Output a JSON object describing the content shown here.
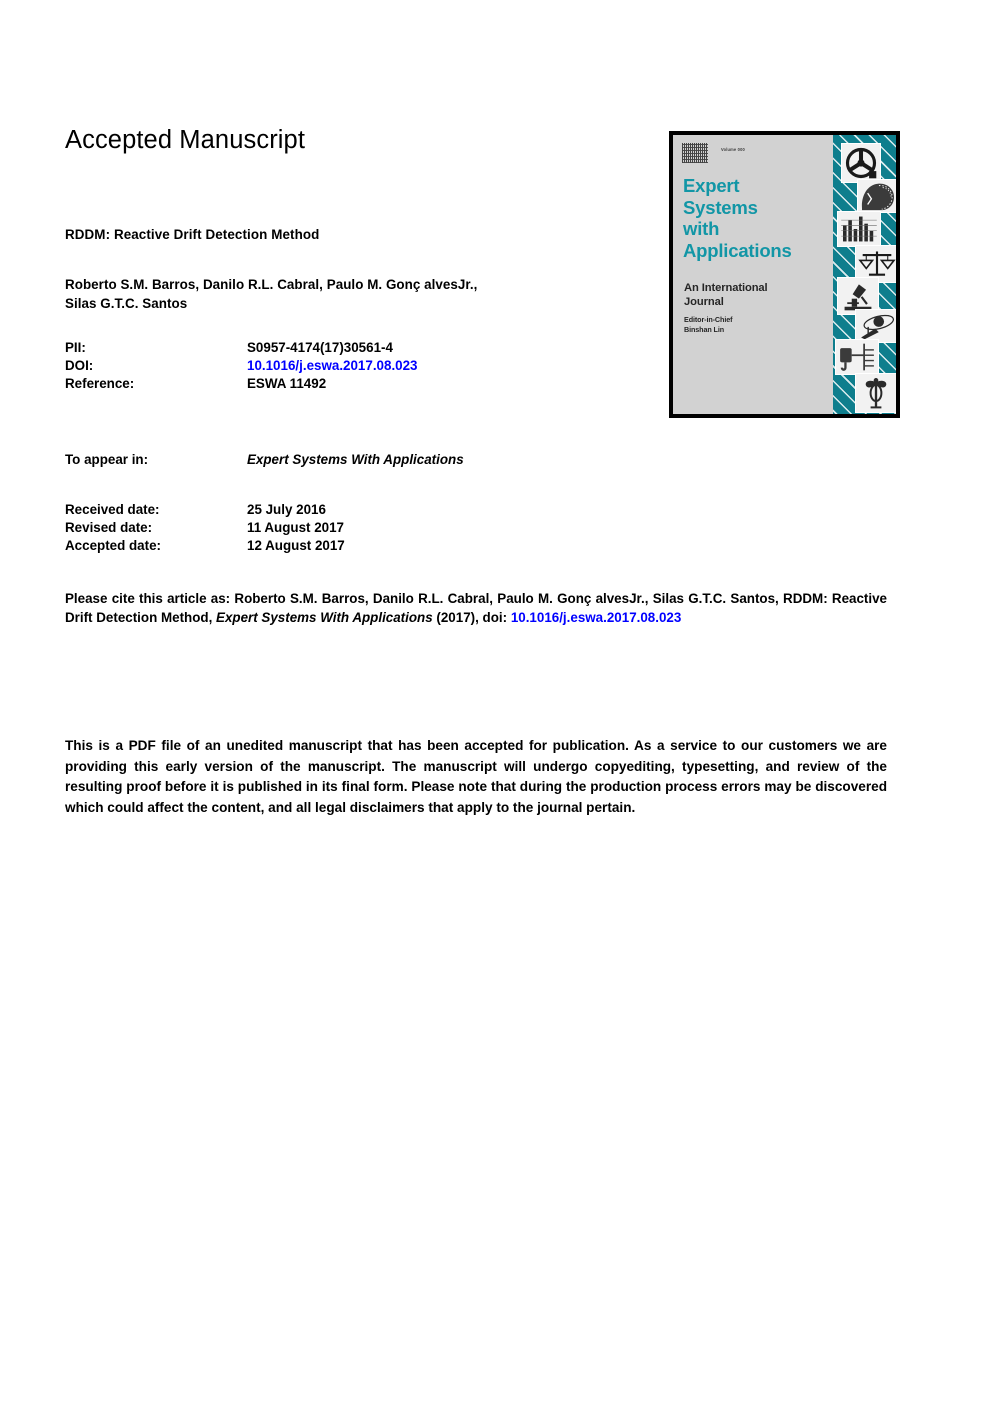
{
  "header": {
    "accepted_manuscript": "Accepted Manuscript"
  },
  "article": {
    "title": "RDDM: Reactive Drift Detection Method",
    "authors_line_1": "Roberto S.M. Barros, Danilo R.L. Cabral, Paulo M. Gonç alvesJr.,",
    "authors_line_2": "Silas G.T.C. Santos"
  },
  "metadata": {
    "pii_label": "PII:",
    "pii_value": "S0957-4174(17)30561-4",
    "doi_label": "DOI:",
    "doi_value": "10.1016/j.eswa.2017.08.023",
    "reference_label": "Reference:",
    "reference_value": "ESWA 11492"
  },
  "appear": {
    "label": "To appear in:",
    "value": "Expert Systems With Applications"
  },
  "dates": {
    "received_label": "Received date:",
    "received_value": "25 July 2016",
    "revised_label": "Revised date:",
    "revised_value": "11 August 2017",
    "accepted_label": "Accepted date:",
    "accepted_value": "12 August 2017"
  },
  "citation": {
    "intro": "Please cite this article as: Roberto S.M. Barros, Danilo R.L. Cabral, Paulo M. Gonç alvesJr., Silas G.T.C. Santos, RDDM: Reactive Drift Detection Method, ",
    "journal": "Expert Systems With Applications",
    "year": " (2017), doi: ",
    "doi": "10.1016/j.eswa.2017.08.023"
  },
  "disclaimer": {
    "text": "This is a PDF file of an unedited manuscript that has been accepted for publication. As a service to our customers we are providing this early version of the manuscript. The manuscript will undergo copyediting, typesetting, and review of the resulting proof before it is published in its final form. Please note that during the production process errors may be discovered which could affect the content, and all legal disclaimers that apply to the journal pertain."
  },
  "cover": {
    "issue_text": "Volume 000",
    "title_line_1": "Expert",
    "title_line_2": "Systems",
    "title_line_3": "with",
    "title_line_4": "Applications",
    "subtitle_line_1": "An International",
    "subtitle_line_2": "Journal",
    "editor_label": "Editor-in-Chief",
    "editor_name": "Binshan Lin",
    "icons": [
      "gear-icon",
      "head-profile-icon",
      "bar-chart-icon",
      "scales-of-justice-icon",
      "microscope-icon",
      "satellite-icon",
      "circuit-icon",
      "caduceus-icon"
    ]
  },
  "colors": {
    "link": "#0000FF",
    "cover_teal": "#0E7E8D",
    "cover_title_teal": "#1296A6",
    "cover_gray": "#D2D2D2"
  }
}
